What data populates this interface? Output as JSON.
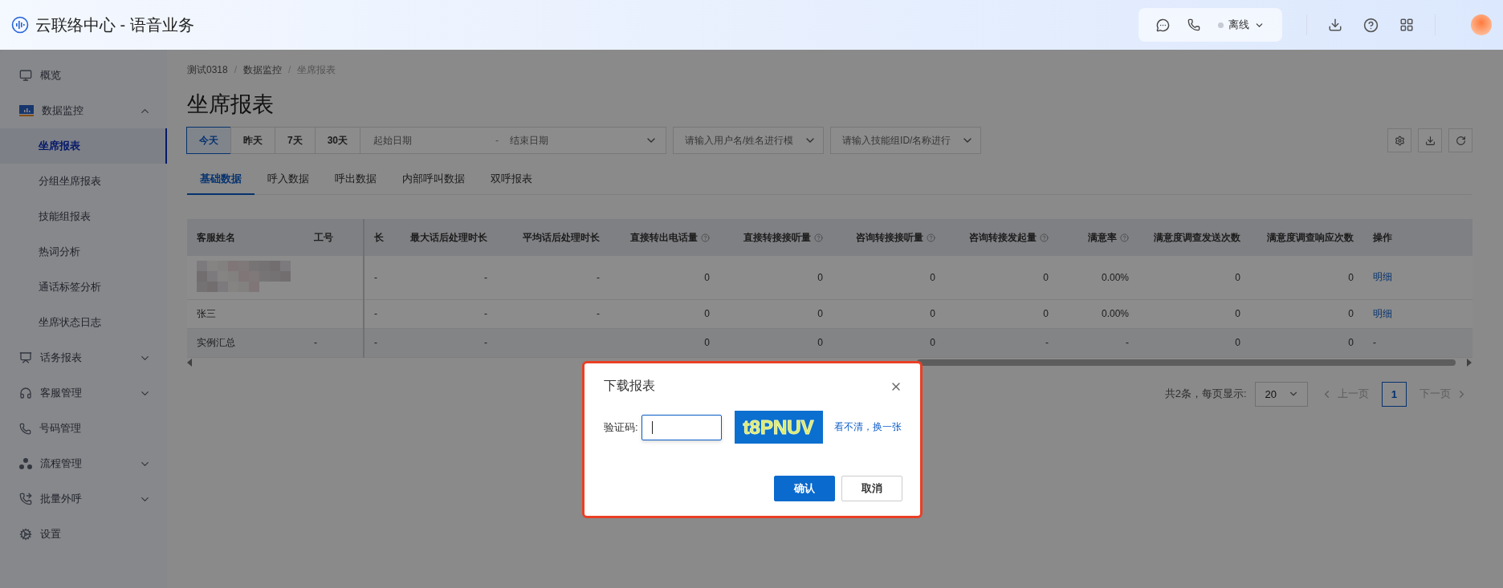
{
  "app": {
    "title": "云联络中心 - 语音业务"
  },
  "header": {
    "status": "离线"
  },
  "sidebar": {
    "items": [
      {
        "label": "概览",
        "selected": false
      },
      {
        "label": "数据监控",
        "selected": false,
        "expanded": true,
        "children": [
          {
            "label": "坐席报表",
            "selected": true
          },
          {
            "label": "分组坐席报表",
            "selected": false
          },
          {
            "label": "技能组报表",
            "selected": false
          },
          {
            "label": "热词分析",
            "selected": false
          },
          {
            "label": "通话标签分析",
            "selected": false
          },
          {
            "label": "坐席状态日志",
            "selected": false
          }
        ]
      },
      {
        "label": "话务报表",
        "selected": false,
        "expanded": false
      },
      {
        "label": "客服管理",
        "selected": false,
        "expanded": false
      },
      {
        "label": "号码管理",
        "selected": false
      },
      {
        "label": "流程管理",
        "selected": false,
        "expanded": false
      },
      {
        "label": "批量外呼",
        "selected": false,
        "expanded": false
      },
      {
        "label": "设置",
        "selected": false
      }
    ]
  },
  "breadcrumb": [
    "测试0318",
    "数据监控",
    "坐席报表"
  ],
  "breadcrumb_separator": "/",
  "page_title": "坐席报表",
  "date_buttons": [
    {
      "label": "今天",
      "selected": true
    },
    {
      "label": "昨天",
      "selected": false
    },
    {
      "label": "7天",
      "selected": false
    },
    {
      "label": "30天",
      "selected": false
    }
  ],
  "date_range": {
    "start_placeholder": "起始日期",
    "separator": "-",
    "end_placeholder": "结束日期"
  },
  "filters": [
    {
      "placeholder": "请输入用户名/姓名进行模"
    },
    {
      "placeholder": "请输入技能组ID/名称进行"
    }
  ],
  "tabs": [
    {
      "label": "基础数据",
      "selected": true
    },
    {
      "label": "呼入数据",
      "selected": false
    },
    {
      "label": "呼出数据",
      "selected": false
    },
    {
      "label": "内部呼叫数据",
      "selected": false
    },
    {
      "label": "双呼报表",
      "selected": false
    }
  ],
  "table": {
    "columns": [
      {
        "label": "客服姓名",
        "kind": "text",
        "help": false
      },
      {
        "label": "工号",
        "kind": "text",
        "help": false
      },
      {
        "label": "长",
        "kind": "text",
        "help": false
      },
      {
        "label": "最大话后处理时长",
        "kind": "number",
        "help": false
      },
      {
        "label": "平均话后处理时长",
        "kind": "number",
        "help": false
      },
      {
        "label": "直接转出电话量",
        "kind": "number",
        "help": true
      },
      {
        "label": "直接转接接听量",
        "kind": "number",
        "help": true
      },
      {
        "label": "咨询转接接听量",
        "kind": "number",
        "help": true
      },
      {
        "label": "咨询转接发起量",
        "kind": "number",
        "help": true
      },
      {
        "label": "满意率",
        "kind": "number",
        "help": true
      },
      {
        "label": "满意度调查发送次数",
        "kind": "number",
        "help": false
      },
      {
        "label": "满意度调查响应次数",
        "kind": "number",
        "help": false
      },
      {
        "label": "操作",
        "kind": "action",
        "help": false
      }
    ],
    "rows": [
      {
        "kind": "blurred",
        "cells": [
          null,
          null,
          "-",
          "-",
          "-",
          "0",
          "0",
          "0",
          "0",
          "0.00%",
          "0",
          "0",
          "明细"
        ]
      },
      {
        "kind": "agent",
        "cells": [
          "张三",
          null,
          "-",
          "-",
          "-",
          "0",
          "0",
          "0",
          "0",
          "0.00%",
          "0",
          "0",
          "明细"
        ]
      },
      {
        "kind": "summary",
        "cells": [
          "实例汇总",
          "-",
          "-",
          "-",
          null,
          "0",
          "0",
          "0",
          "-",
          "-",
          "0",
          "0",
          "-"
        ]
      }
    ]
  },
  "pagination": {
    "total": "共2条，每页显示:",
    "page_size": "20",
    "prev": "上一页",
    "next": "下一页",
    "pages": [
      {
        "label": "1",
        "selected": true
      }
    ]
  },
  "dialog": {
    "title": "下载报表",
    "label": "验证码:",
    "captcha": "t8PNUV",
    "refresh_link": "看不清，换一张",
    "buttons": [
      {
        "label": "确认",
        "kind": "primary"
      },
      {
        "label": "取消",
        "kind": "default"
      }
    ]
  }
}
